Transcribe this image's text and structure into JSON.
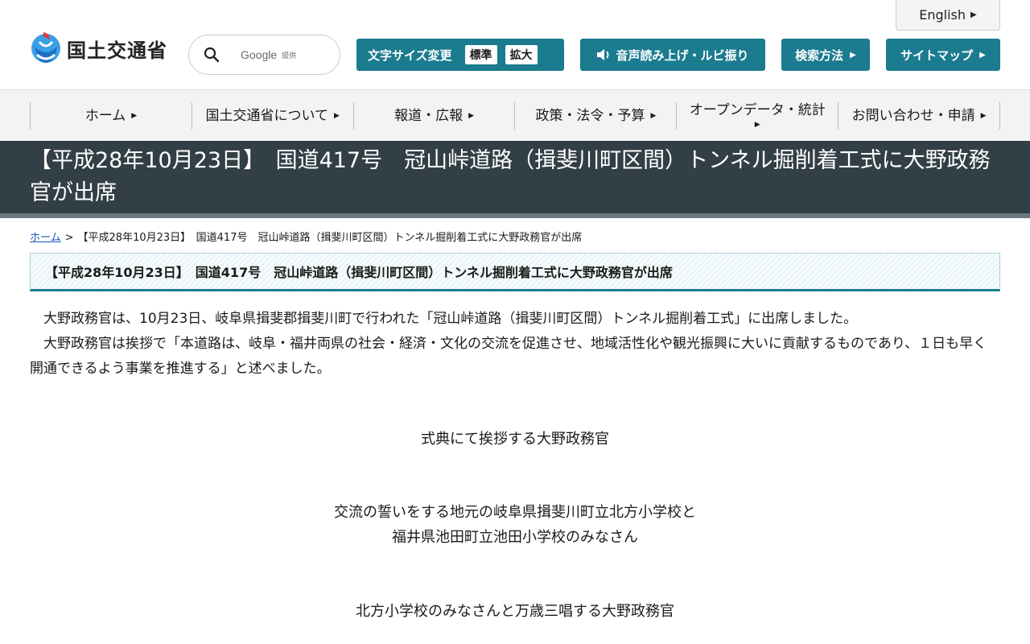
{
  "header": {
    "language_label": "English",
    "logo_text": "国土交通省",
    "search": {
      "provider": "Google",
      "provided_label": "提供"
    },
    "font_size": {
      "label": "文字サイズ変更",
      "standard_label": "標準",
      "large_label": "拡大"
    },
    "voice_label": "音声読み上げ・ルビ振り",
    "search_method_label": "検索方法",
    "sitemap_label": "サイトマップ",
    "accent_color": "#1b7b8f"
  },
  "nav": {
    "items": [
      {
        "label": "ホーム"
      },
      {
        "label": "国土交通省について"
      },
      {
        "label": "報道・広報"
      },
      {
        "label": "政策・法令・予算"
      },
      {
        "label": "オープンデータ・統計"
      },
      {
        "label": "お問い合わせ・申請"
      }
    ]
  },
  "page": {
    "title": "【平成28年10月23日】　国道417号　冠山峠道路（揖斐川町区間）トンネル掘削着工式に大野政務官が出席",
    "breadcrumb": {
      "home": "ホーム",
      "separator": ">",
      "current": "【平成28年10月23日】　国道417号　冠山峠道路（揖斐川町区間）トンネル掘削着工式に大野政務官が出席"
    },
    "heading": "【平成28年10月23日】　国道417号　冠山峠道路（揖斐川町区間）トンネル掘削着工式に大野政務官が出席",
    "paragraphs": [
      "大野政務官は、10月23日、岐阜県揖斐郡揖斐川町で行われた「冠山峠道路（揖斐川町区間）トンネル掘削着工式」に出席しました。",
      "大野政務官は挨拶で「本道路は、岐阜・福井両県の社会・経済・文化の交流を促進させ、地域活性化や観光振興に大いに貢献するものであり、１日も早く開通できるよう事業を推進する」と述べました。"
    ],
    "captions": [
      {
        "lines": [
          "式典にて挨拶する大野政務官"
        ]
      },
      {
        "lines": [
          "交流の誓いをする地元の岐阜県揖斐川町立北方小学校と",
          "福井県池田町立池田小学校のみなさん"
        ]
      },
      {
        "lines": [
          "北方小学校のみなさんと万歳三唱する大野政務官"
        ]
      }
    ]
  }
}
